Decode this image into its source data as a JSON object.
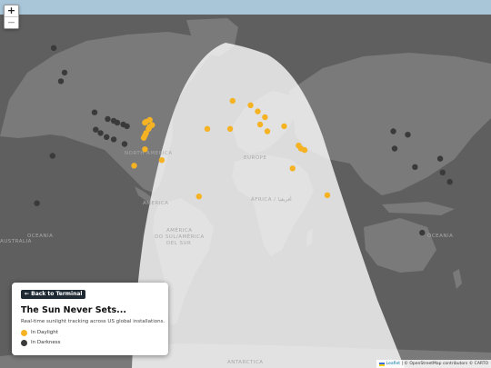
{
  "map": {
    "zoom_in_label": "+",
    "zoom_out_label": "−",
    "labels": {
      "north_america": "NORTH AMERICA",
      "america": "AMERICA",
      "europe": "EUROPE",
      "africa": "ÁFRICA / أفريقيا",
      "south_america_1": "AMÉRICA",
      "south_america_2": "DO SUL/AMÉRICA",
      "south_america_3": "DEL SUR",
      "oceania_left": "OCEANIA",
      "oceania_right": "OCEANIA",
      "australia": "AUSTRALIA",
      "antarctica": "ANTARCTICA"
    },
    "colors": {
      "ocean": "#5f5f5f",
      "land": "#7a7a7a",
      "daylight_overlay": "#ffffff",
      "daylight_marker": "#f5b324",
      "darkness_marker": "#3a3a3a"
    },
    "daylight_markers": [
      {
        "lat": 43.5,
        "lon": -76
      },
      {
        "lat": 42.5,
        "lon": -79
      },
      {
        "lat": 42,
        "lon": -80
      },
      {
        "lat": 40.7,
        "lon": -74
      },
      {
        "lat": 39.7,
        "lon": -76
      },
      {
        "lat": 38.5,
        "lon": -77
      },
      {
        "lat": 36,
        "lon": -79
      },
      {
        "lat": 34.5,
        "lon": -80
      },
      {
        "lat": 33,
        "lon": -81
      },
      {
        "lat": 25.5,
        "lon": -80
      },
      {
        "lat": 18,
        "lon": -66
      },
      {
        "lat": 14,
        "lon": -89
      },
      {
        "lat": 38.5,
        "lon": -28
      },
      {
        "lat": 53,
        "lon": -7
      },
      {
        "lat": 51,
        "lon": 8
      },
      {
        "lat": 48,
        "lon": 14
      },
      {
        "lat": 45,
        "lon": 20
      },
      {
        "lat": 41,
        "lon": 16
      },
      {
        "lat": 38.5,
        "lon": -9
      },
      {
        "lat": 37,
        "lon": 22
      },
      {
        "lat": 40,
        "lon": 36
      },
      {
        "lat": 28,
        "lon": 48
      },
      {
        "lat": 26,
        "lon": 50
      },
      {
        "lat": 25,
        "lon": 53
      },
      {
        "lat": 12,
        "lon": 43
      },
      {
        "lat": -8,
        "lon": 72
      },
      {
        "lat": -9,
        "lon": -35
      }
    ],
    "darkness_markers": [
      {
        "lat": 71,
        "lon": -156
      },
      {
        "lat": 64,
        "lon": -147
      },
      {
        "lat": 61,
        "lon": -150
      },
      {
        "lat": 47.5,
        "lon": -122
      },
      {
        "lat": 44,
        "lon": -111
      },
      {
        "lat": 43,
        "lon": -106
      },
      {
        "lat": 42,
        "lon": -103
      },
      {
        "lat": 41,
        "lon": -98
      },
      {
        "lat": 40,
        "lon": -95
      },
      {
        "lat": 38,
        "lon": -121
      },
      {
        "lat": 36,
        "lon": -117
      },
      {
        "lat": 33.5,
        "lon": -112
      },
      {
        "lat": 32,
        "lon": -106
      },
      {
        "lat": 29,
        "lon": -97
      },
      {
        "lat": 21,
        "lon": -157
      },
      {
        "lat": 37,
        "lon": 127
      },
      {
        "lat": 35,
        "lon": 139
      },
      {
        "lat": 26,
        "lon": 128
      },
      {
        "lat": 13,
        "lon": 145
      },
      {
        "lat": 9,
        "lon": 168
      },
      {
        "lat": 2,
        "lon": 174
      },
      {
        "lat": 19,
        "lon": 166
      },
      {
        "lat": -14,
        "lon": -170
      },
      {
        "lat": -34,
        "lon": 151
      }
    ]
  },
  "panel": {
    "back_label": "← Back to Terminal",
    "title": "The Sun Never Sets...",
    "subtitle": "Real-time sunlight tracking across US global installations.",
    "legend_daylight": "In Daylight",
    "legend_darkness": "In Darkness"
  },
  "attribution": {
    "leaflet": "Leaflet",
    "rest": "| © OpenStreetMap contributors © CARTO"
  }
}
